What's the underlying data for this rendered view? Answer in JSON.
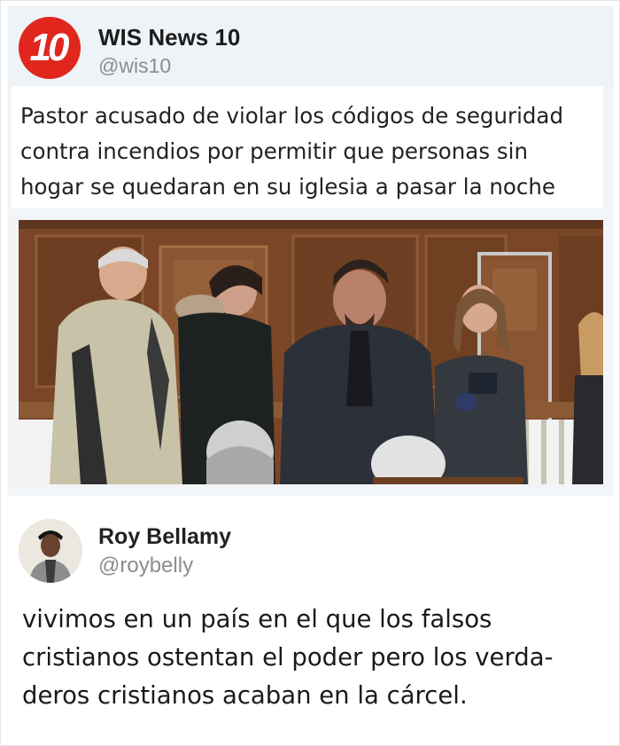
{
  "tweet1": {
    "logo_text": "10",
    "display_name": "WIS News 10",
    "handle": "@wis10",
    "text": "Pastor acusado de violar los códigos de seguridad contra incendios por permitir que personas sin hogar se quedaran en su iglesia a pasar la noche"
  },
  "tweet2": {
    "display_name": "Roy Bellamy",
    "handle": "@roybelly",
    "text": "vivimos en un país en el que los falsos cristianos ostentan el poder pero los verda-deros cristianos acaban en la cárcel."
  },
  "colors": {
    "logo_red": "#e0261d",
    "handle_gray": "#8a8d91",
    "header_bg": "#eef3f7"
  }
}
